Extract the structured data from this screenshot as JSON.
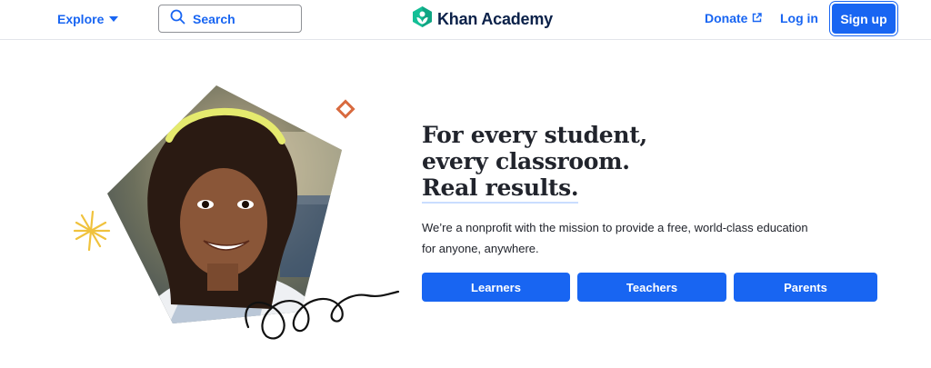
{
  "header": {
    "explore_label": "Explore",
    "search_placeholder": "Search",
    "logo_text": "Khan Academy",
    "donate_label": "Donate",
    "login_label": "Log in",
    "signup_label": "Sign up"
  },
  "hero": {
    "headline_line1": "For every student,",
    "headline_line2": "every classroom.",
    "headline_line3": "Real results.",
    "mission": "We’re a nonprofit with the mission to provide a free, world-class education for anyone, anywhere.",
    "buttons": [
      {
        "label": "Learners"
      },
      {
        "label": "Teachers"
      },
      {
        "label": "Parents"
      }
    ],
    "photo_subject": "smiling student in school uniform"
  },
  "icons": {
    "explore": "chevron-down-icon",
    "search": "search-icon",
    "logo": "khan-academy-logo-icon",
    "donate": "external-link-icon"
  },
  "colors": {
    "brand_blue": "#1865f2",
    "logo_green": "#14bf96",
    "navy_text": "#0b2149",
    "body_text": "#21242c",
    "accent_orange": "#d86a3f",
    "accent_yellow": "#f0c23d"
  }
}
